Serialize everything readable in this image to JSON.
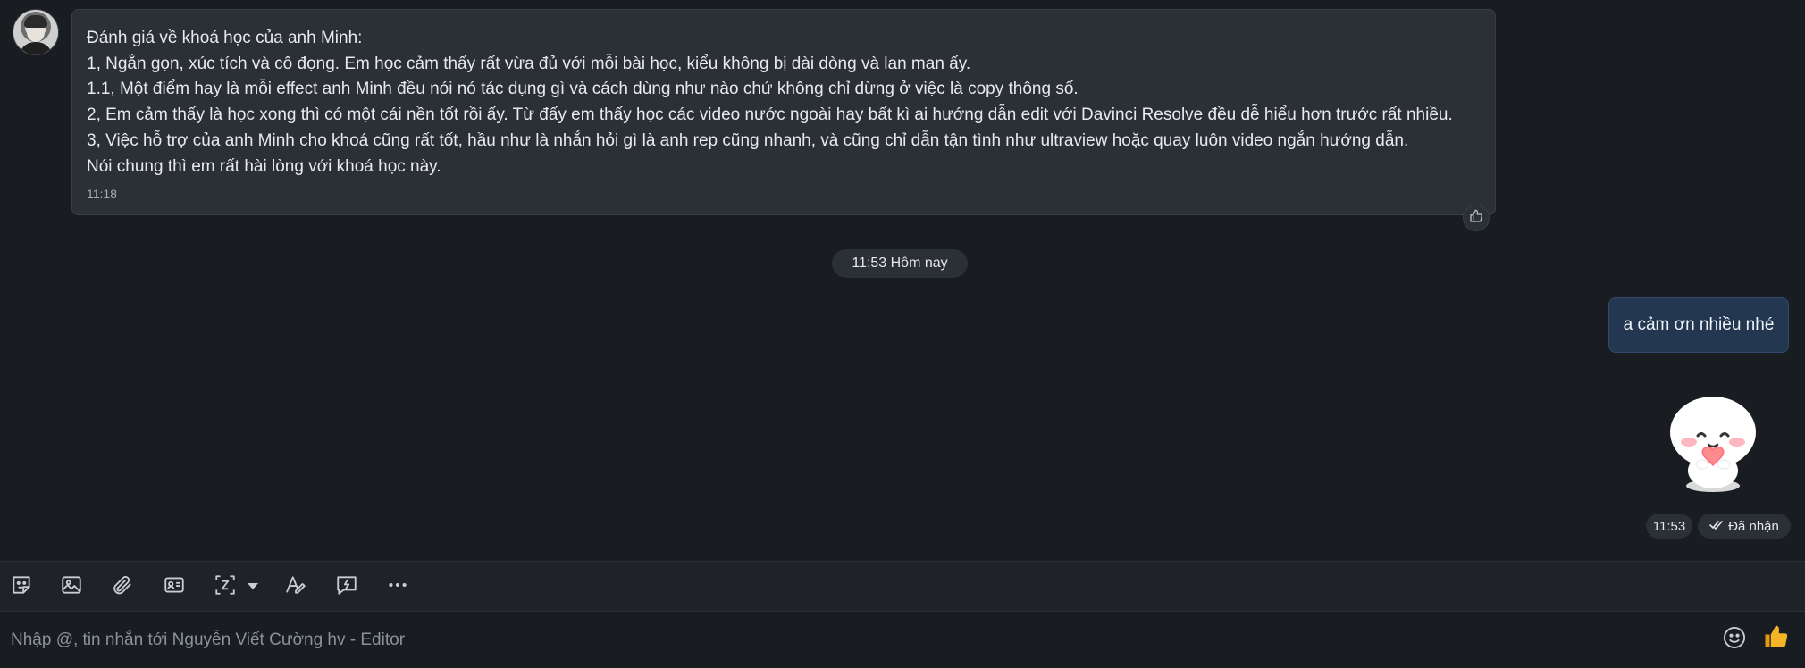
{
  "incoming": {
    "lines": [
      "Đánh giá về khoá học của anh Minh:",
      "1, Ngắn gọn, xúc tích và cô đọng. Em học cảm thấy rất vừa đủ với mỗi bài học, kiểu không bị dài dòng và lan man ấy.",
      "1.1, Một điểm hay là mỗi effect anh Minh đều nói nó tác dụng gì và cách dùng như nào chứ không chỉ dừng ở việc là copy thông số.",
      "2, Em cảm thấy là học xong thì có một cái nền tốt rồi ấy. Từ đấy em thấy học các video nước ngoài hay bất kì ai hướng dẫn edit với Davinci Resolve đều dễ hiểu hơn trước rất nhiều.",
      "3, Việc hỗ trợ của anh Minh cho khoá cũng rất tốt, hầu như là nhắn hỏi gì là anh rep cũng nhanh, và cũng chỉ dẫn tận tình như ultraview hoặc quay luôn video ngắn hướng dẫn.",
      "Nói chung thì em rất hài lòng với khoá học này."
    ],
    "time": "11:18"
  },
  "date_divider": "11:53 Hôm nay",
  "outgoing": {
    "text": "a cảm ơn nhiều nhé",
    "time": "11:53",
    "status": "Đã nhận"
  },
  "composer": {
    "placeholder": "Nhập @, tin nhắn tới Nguyễn Viết Cường hv - Editor"
  },
  "toolbar_icons": [
    "sticker-icon",
    "image-icon",
    "attachment-icon",
    "contact-card-icon",
    "screenshot-icon",
    "text-format-icon",
    "quick-message-icon",
    "more-icon"
  ],
  "colors": {
    "background": "#191c21",
    "incoming_bubble": "#2b2f36",
    "outgoing_bubble": "#243750",
    "thumb": "#f5b326"
  }
}
